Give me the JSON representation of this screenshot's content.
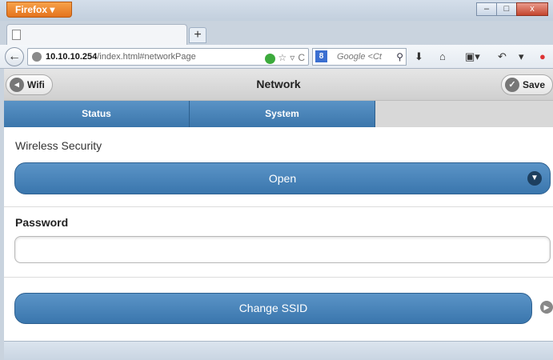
{
  "browser": {
    "app_button_label": "Firefox ▾",
    "window_controls": {
      "minimize": "–",
      "maximize": "□",
      "close": "x"
    },
    "new_tab_label": "+",
    "back_label": "←",
    "url_host": "10.10.10.254",
    "url_path": "/index.html#networkPage",
    "search_engine_badge": "8",
    "search_placeholder": "Google <Ct",
    "toolbar_icons": [
      "download-icon",
      "home-icon",
      "bookmarks-icon",
      "undo-icon",
      "addon-icon"
    ]
  },
  "header": {
    "title": "Network",
    "left_button_label": "Wifi",
    "right_button_label": "Save"
  },
  "tabs": [
    {
      "label": "Status"
    },
    {
      "label": "System"
    }
  ],
  "form": {
    "wireless_security_label": "Wireless Security",
    "security_selected": "Open",
    "password_label": "Password",
    "password_value": "",
    "change_ssid_label": "Change SSID"
  },
  "colors": {
    "accent": "#4a86bb",
    "firefox_orange": "#e4731d"
  }
}
